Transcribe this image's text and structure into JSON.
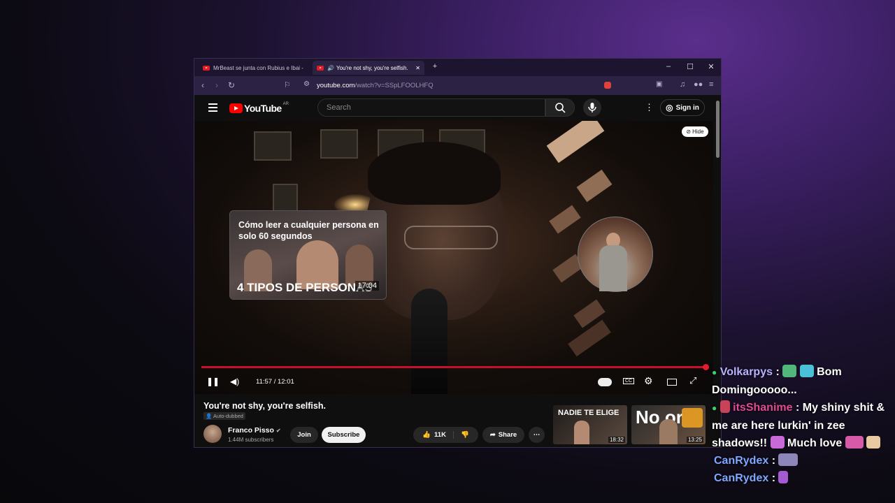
{
  "browser": {
    "tabs": [
      {
        "title": "MrBeast se junta con Rubius e Ibai -",
        "active": false
      },
      {
        "title": "You're not shy, you're selfish.",
        "active": true
      }
    ],
    "new_tab": "+",
    "url_domain": "youtube.com",
    "url_path": "/watch?v=SSpLFOOLHFQ",
    "window_controls": {
      "minimize": "–",
      "maximize": "☐",
      "close": "✕"
    }
  },
  "youtube": {
    "logo_text": "YouTube",
    "region": "AR",
    "search_placeholder": "Search",
    "sign_in": "Sign in"
  },
  "player": {
    "hide_label": "Hide",
    "current_time": "11:57",
    "duration": "12:01",
    "time_display": "11:57 / 12:01",
    "progress_fraction": 0.994,
    "endcard": {
      "title": "Cómo leer a cualquier persona en solo 60 segundos",
      "banner": "4 TIPOS DE PERSONAS",
      "duration": "17:04"
    }
  },
  "video": {
    "title": "You're not shy, you're selfish.",
    "auto_dubbed": "Auto-dubbed",
    "channel": "Franco Pisso",
    "subscribers": "1.44M subscribers",
    "join": "Join",
    "subscribe": "Subscribe",
    "likes": "11K",
    "share": "Share"
  },
  "related": [
    {
      "title": "NADIE TE ELIGE",
      "duration": "18:32"
    },
    {
      "title": "No  or",
      "duration": "13:25"
    }
  ],
  "chat": [
    {
      "user": "Volkarpys",
      "sep": " : ",
      "message": " Bom Domingooooo..."
    },
    {
      "user": "itsShanime",
      "sep": " : ",
      "message": "My shiny shit & me are here lurkin' in zee shadows!! ",
      "message2": " Much love "
    },
    {
      "user": "CanRydex",
      "sep": " : ",
      "message": ""
    },
    {
      "user": "CanRydex",
      "sep": " : ",
      "message": ""
    }
  ],
  "colors": {
    "accent_red": "#ff0000",
    "browser_purple": "#2c2243",
    "chat_name_1": "#b9b2ff",
    "chat_name_2": "#e04b8f",
    "chat_name_3": "#7ea7ff"
  }
}
